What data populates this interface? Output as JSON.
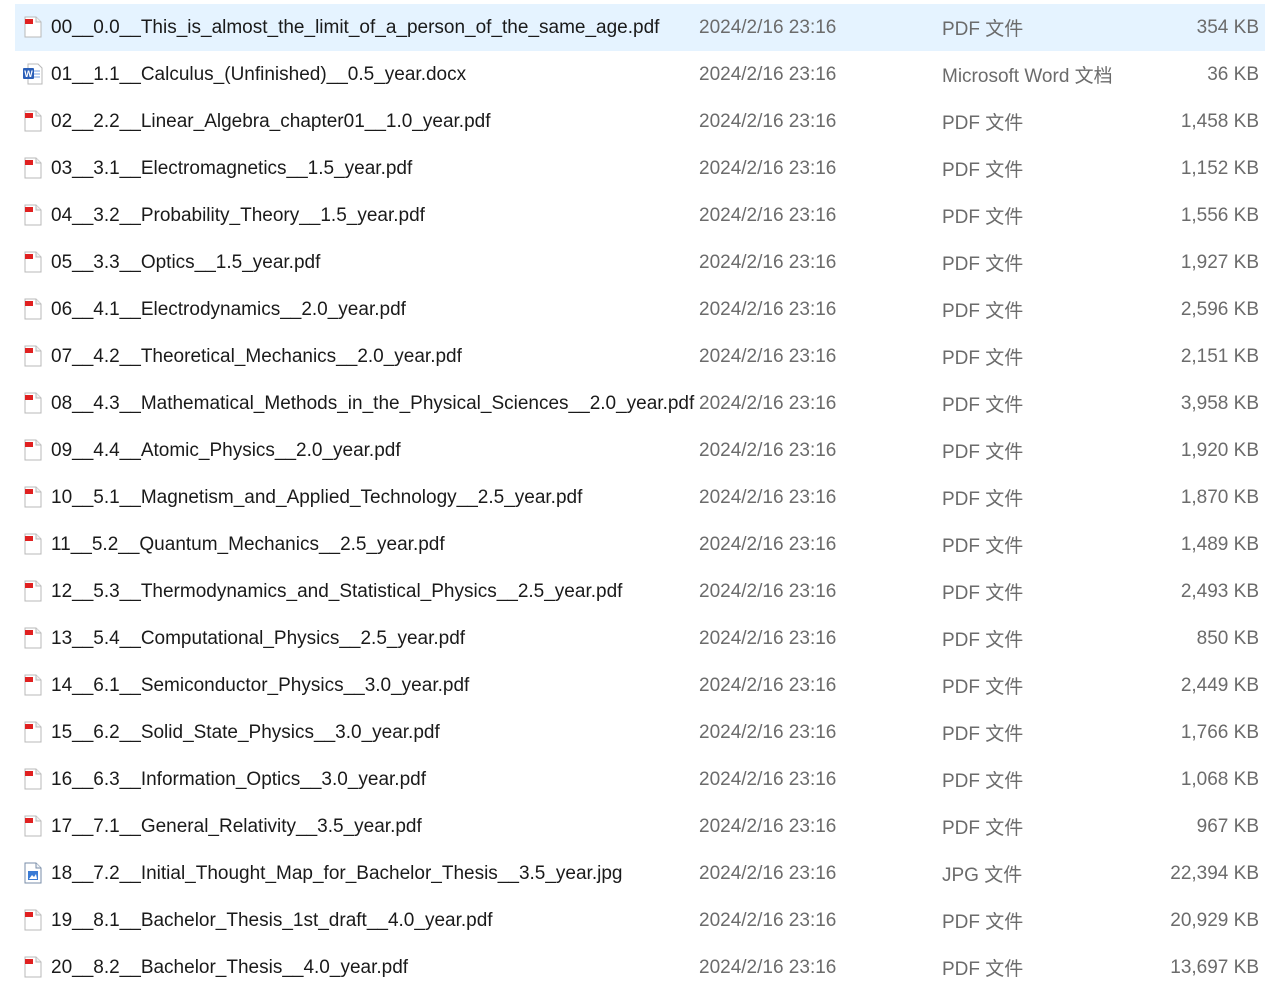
{
  "files": [
    {
      "name": "00__0.0__This_is_almost_the_limit_of_a_person_of_the_same_age.pdf",
      "modified": "2024/2/16 23:16",
      "type": "PDF 文件",
      "size": "354 KB",
      "icon": "pdf-file-icon",
      "selected": true
    },
    {
      "name": "01__1.1__Calculus_(Unfinished)__0.5_year.docx",
      "modified": "2024/2/16 23:16",
      "type": "Microsoft Word 文档",
      "size": "36 KB",
      "icon": "word-file-icon"
    },
    {
      "name": "02__2.2__Linear_Algebra_chapter01__1.0_year.pdf",
      "modified": "2024/2/16 23:16",
      "type": "PDF 文件",
      "size": "1,458 KB",
      "icon": "pdf-file-icon"
    },
    {
      "name": "03__3.1__Electromagnetics__1.5_year.pdf",
      "modified": "2024/2/16 23:16",
      "type": "PDF 文件",
      "size": "1,152 KB",
      "icon": "pdf-file-icon"
    },
    {
      "name": "04__3.2__Probability_Theory__1.5_year.pdf",
      "modified": "2024/2/16 23:16",
      "type": "PDF 文件",
      "size": "1,556 KB",
      "icon": "pdf-file-icon"
    },
    {
      "name": "05__3.3__Optics__1.5_year.pdf",
      "modified": "2024/2/16 23:16",
      "type": "PDF 文件",
      "size": "1,927 KB",
      "icon": "pdf-file-icon"
    },
    {
      "name": "06__4.1__Electrodynamics__2.0_year.pdf",
      "modified": "2024/2/16 23:16",
      "type": "PDF 文件",
      "size": "2,596 KB",
      "icon": "pdf-file-icon"
    },
    {
      "name": "07__4.2__Theoretical_Mechanics__2.0_year.pdf",
      "modified": "2024/2/16 23:16",
      "type": "PDF 文件",
      "size": "2,151 KB",
      "icon": "pdf-file-icon"
    },
    {
      "name": "08__4.3__Mathematical_Methods_in_the_Physical_Sciences__2.0_year.pdf",
      "modified": "2024/2/16 23:16",
      "type": "PDF 文件",
      "size": "3,958 KB",
      "icon": "pdf-file-icon"
    },
    {
      "name": "09__4.4__Atomic_Physics__2.0_year.pdf",
      "modified": "2024/2/16 23:16",
      "type": "PDF 文件",
      "size": "1,920 KB",
      "icon": "pdf-file-icon"
    },
    {
      "name": "10__5.1__Magnetism_and_Applied_Technology__2.5_year.pdf",
      "modified": "2024/2/16 23:16",
      "type": "PDF 文件",
      "size": "1,870 KB",
      "icon": "pdf-file-icon"
    },
    {
      "name": "11__5.2__Quantum_Mechanics__2.5_year.pdf",
      "modified": "2024/2/16 23:16",
      "type": "PDF 文件",
      "size": "1,489 KB",
      "icon": "pdf-file-icon"
    },
    {
      "name": "12__5.3__Thermodynamics_and_Statistical_Physics__2.5_year.pdf",
      "modified": "2024/2/16 23:16",
      "type": "PDF 文件",
      "size": "2,493 KB",
      "icon": "pdf-file-icon"
    },
    {
      "name": "13__5.4__Computational_Physics__2.5_year.pdf",
      "modified": "2024/2/16 23:16",
      "type": "PDF 文件",
      "size": "850 KB",
      "icon": "pdf-file-icon"
    },
    {
      "name": "14__6.1__Semiconductor_Physics__3.0_year.pdf",
      "modified": "2024/2/16 23:16",
      "type": "PDF 文件",
      "size": "2,449 KB",
      "icon": "pdf-file-icon"
    },
    {
      "name": "15__6.2__Solid_State_Physics__3.0_year.pdf",
      "modified": "2024/2/16 23:16",
      "type": "PDF 文件",
      "size": "1,766 KB",
      "icon": "pdf-file-icon"
    },
    {
      "name": "16__6.3__Information_Optics__3.0_year.pdf",
      "modified": "2024/2/16 23:16",
      "type": "PDF 文件",
      "size": "1,068 KB",
      "icon": "pdf-file-icon"
    },
    {
      "name": "17__7.1__General_Relativity__3.5_year.pdf",
      "modified": "2024/2/16 23:16",
      "type": "PDF 文件",
      "size": "967 KB",
      "icon": "pdf-file-icon"
    },
    {
      "name": "18__7.2__Initial_Thought_Map_for_Bachelor_Thesis__3.5_year.jpg",
      "modified": "2024/2/16 23:16",
      "type": "JPG 文件",
      "size": "22,394 KB",
      "icon": "image-file-icon"
    },
    {
      "name": "19__8.1__Bachelor_Thesis_1st_draft__4.0_year.pdf",
      "modified": "2024/2/16 23:16",
      "type": "PDF 文件",
      "size": "20,929 KB",
      "icon": "pdf-file-icon"
    },
    {
      "name": "20__8.2__Bachelor_Thesis__4.0_year.pdf",
      "modified": "2024/2/16 23:16",
      "type": "PDF 文件",
      "size": "13,697 KB",
      "icon": "pdf-file-icon"
    }
  ],
  "colors": {
    "selected_row_bg": "#e5f3ff",
    "name_text": "#1a1a1a",
    "meta_text": "#6b6b6b",
    "pdf_red": "#e02020",
    "word_blue": "#2b5fb8",
    "image_blue": "#3a7bd5"
  }
}
